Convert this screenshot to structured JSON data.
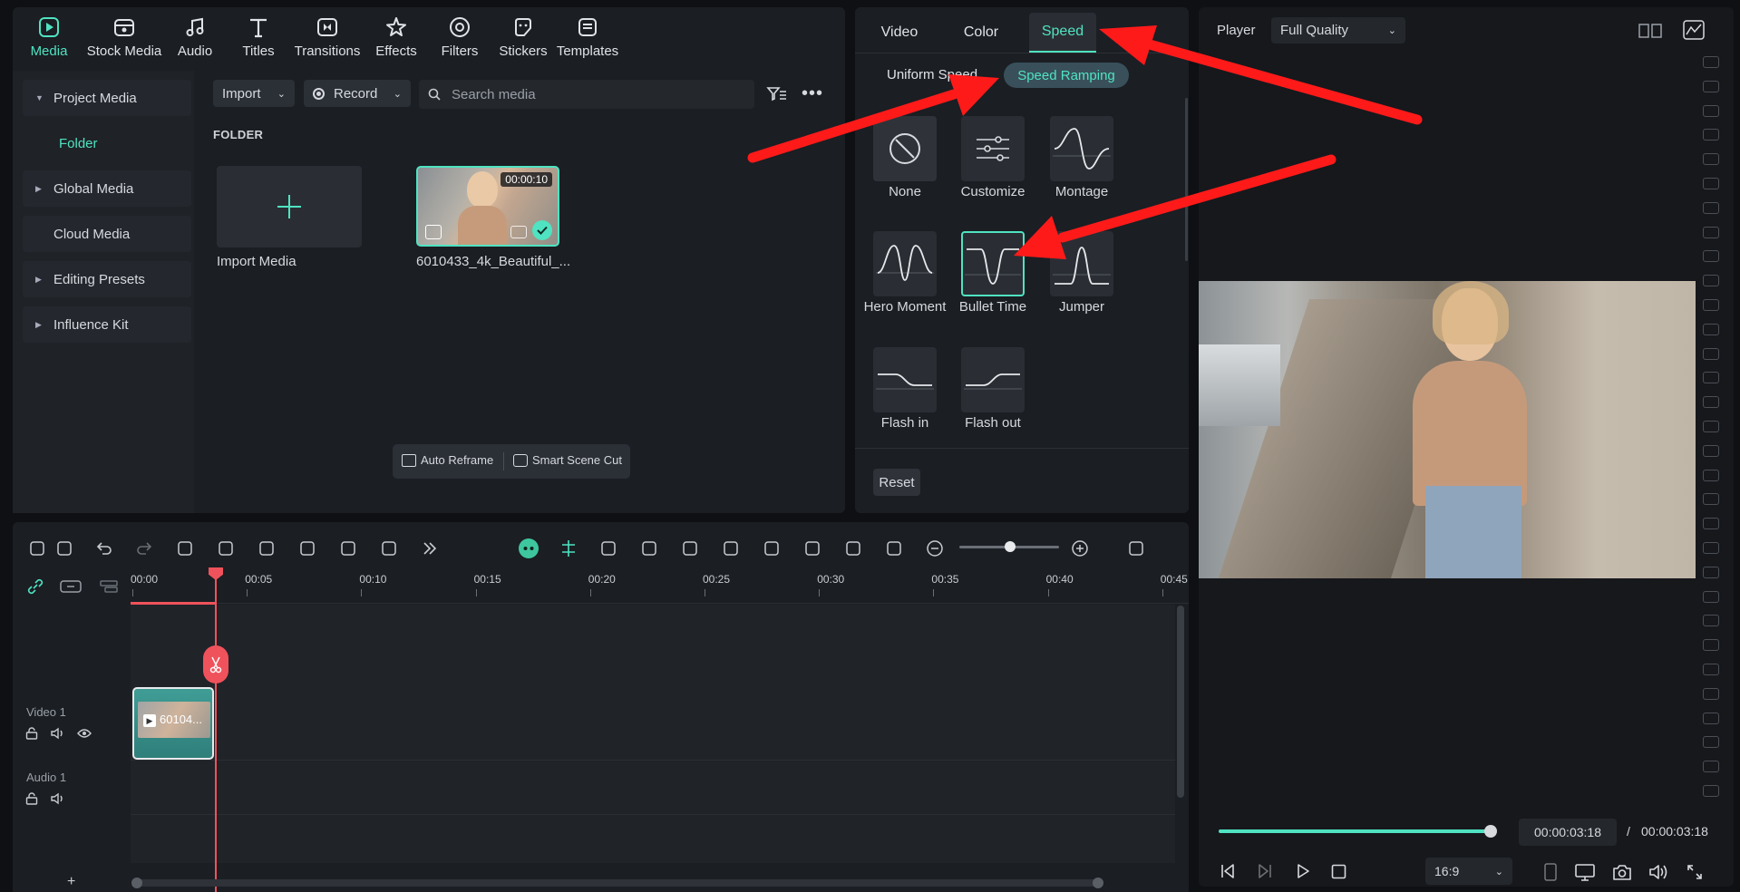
{
  "top_tabs": [
    {
      "label": "Media",
      "icon": "media-icon",
      "active": true
    },
    {
      "label": "Stock Media",
      "icon": "stock-media-icon"
    },
    {
      "label": "Audio",
      "icon": "audio-icon"
    },
    {
      "label": "Titles",
      "icon": "titles-icon"
    },
    {
      "label": "Transitions",
      "icon": "transitions-icon"
    },
    {
      "label": "Effects",
      "icon": "effects-icon"
    },
    {
      "label": "Filters",
      "icon": "filters-icon"
    },
    {
      "label": "Stickers",
      "icon": "stickers-icon"
    },
    {
      "label": "Templates",
      "icon": "templates-icon"
    }
  ],
  "sidebar": {
    "items": [
      {
        "label": "Project Media"
      },
      {
        "label": "Folder"
      },
      {
        "label": "Global Media"
      },
      {
        "label": "Cloud Media"
      },
      {
        "label": "Editing Presets"
      },
      {
        "label": "Influence Kit"
      }
    ]
  },
  "media": {
    "import_label": "Import",
    "record_label": "Record",
    "search_placeholder": "Search media",
    "folder_header": "FOLDER",
    "import_media_label": "Import Media",
    "clip_name": "6010433_4k_Beautiful_...",
    "clip_duration": "00:00:10",
    "auto_reframe": "Auto Reframe",
    "smart_scene_cut": "Smart Scene Cut"
  },
  "properties": {
    "tabs": [
      "Video",
      "Color",
      "Speed"
    ],
    "active_tab": "Speed",
    "subtabs": [
      "Uniform Speed",
      "Speed Ramping"
    ],
    "active_subtab": "Speed Ramping",
    "presets": [
      {
        "label": "None",
        "icon": "none-icon"
      },
      {
        "label": "Customize",
        "icon": "customize-icon"
      },
      {
        "label": "Montage",
        "icon": "montage-curve-icon"
      },
      {
        "label": "Hero Moment",
        "icon": "hero-moment-curve-icon"
      },
      {
        "label": "Bullet Time",
        "icon": "bullet-time-curve-icon",
        "selected": true
      },
      {
        "label": "Jumper",
        "icon": "jumper-curve-icon"
      },
      {
        "label": "Flash in",
        "icon": "flash-in-curve-icon"
      },
      {
        "label": "Flash out",
        "icon": "flash-out-curve-icon"
      }
    ],
    "reset_label": "Reset"
  },
  "player": {
    "title": "Player",
    "quality": "Full Quality",
    "current_time": "00:00:03:18",
    "separator": "/",
    "total_time": "00:00:03:18",
    "aspect": "16:9",
    "progress": 1.0
  },
  "timeline": {
    "ruler": [
      "00:00",
      "00:05",
      "00:10",
      "00:15",
      "00:20",
      "00:25",
      "00:30",
      "00:35",
      "00:40",
      "00:45"
    ],
    "tracks": [
      {
        "name": "Video 1",
        "clip_label": "60104..."
      },
      {
        "name": "Audio 1"
      }
    ],
    "add_track": "+"
  },
  "colors": {
    "accent": "#4fe3c1",
    "playhead": "#f0525c",
    "annotation_arrow": "#ff1a1a"
  }
}
